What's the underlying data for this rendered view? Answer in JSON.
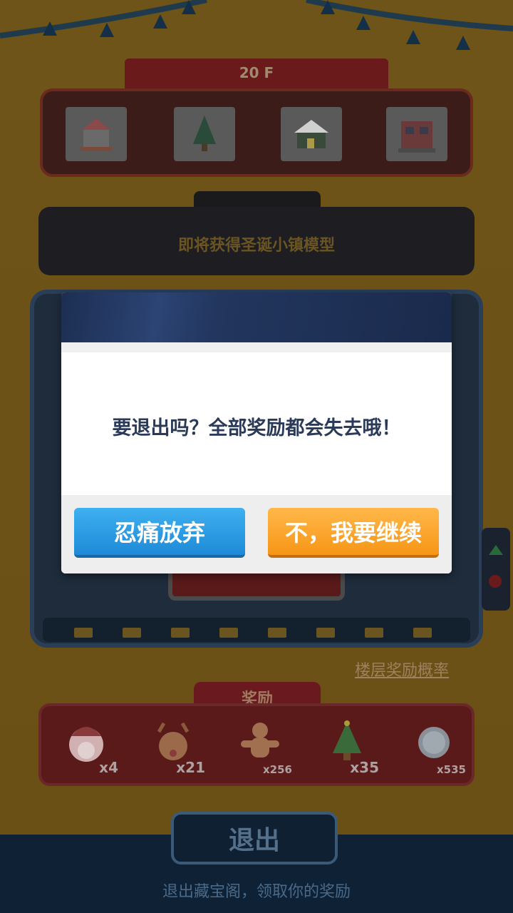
{
  "header": {
    "floor_label": "20 F"
  },
  "shelf": {
    "items": [
      {
        "icon": "carousel-model-icon"
      },
      {
        "icon": "christmas-tree-model-icon"
      },
      {
        "icon": "snowy-house-model-icon"
      },
      {
        "icon": "shop-building-model-icon"
      }
    ]
  },
  "notice": {
    "text": "即将获得圣诞小镇模型"
  },
  "machine": {
    "probability_link": "楼层奖励概率"
  },
  "rewards": {
    "tab_label": "奖励",
    "items": [
      {
        "icon": "santa-icon",
        "count": "x4"
      },
      {
        "icon": "reindeer-icon",
        "count": "x21"
      },
      {
        "icon": "gingerbread-icon",
        "count": "x256"
      },
      {
        "icon": "christmas-tree-icon",
        "count": "x35"
      },
      {
        "icon": "silver-coin-icon",
        "count": "x535"
      }
    ]
  },
  "footer": {
    "exit_label": "退出",
    "exit_hint": "退出藏宝阁，领取你的奖励"
  },
  "dialog": {
    "message": "要退出吗？全部奖励都会失去哦！",
    "abandon_label": "忍痛放弃",
    "continue_label": "不，我要继续"
  },
  "colors": {
    "abandon": "#1e8ad8",
    "continue": "#f79616",
    "modal_header": "#1c2e52"
  }
}
